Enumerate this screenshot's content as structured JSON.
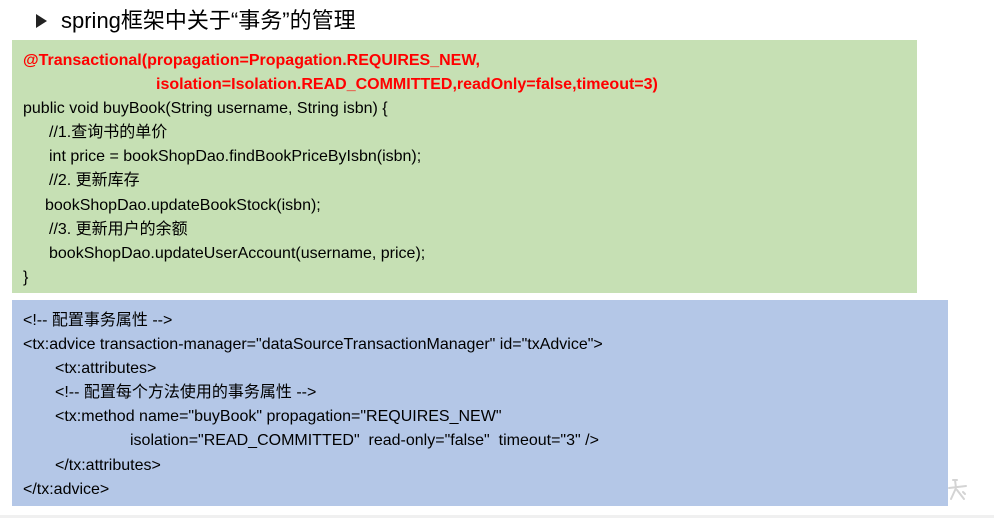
{
  "heading": {
    "text": "spring框架中关于“事务”的管理"
  },
  "java_code": {
    "annotation_line1": "@Transactional(propagation=Propagation.REQUIRES_NEW,",
    "annotation_line2": "isolation=Isolation.READ_COMMITTED,readOnly=false,timeout=3)",
    "method_signature": "public void buyBook(String username, String isbn) {",
    "comment1": "//1.查询书的单价",
    "line_price": "int price = bookShopDao.findBookPriceByIsbn(isbn);",
    "comment2": "//2. 更新库存",
    "line_stock": "bookShopDao.updateBookStock(isbn);",
    "comment3": "//3. 更新用户的余额",
    "line_account": "bookShopDao.updateUserAccount(username, price);",
    "closing_brace": "}"
  },
  "xml_config": {
    "comment1": "<!-- 配置事务属性 -->",
    "advice_open": "<tx:advice transaction-manager=\"dataSourceTransactionManager\" id=\"txAdvice\">",
    "attributes_open": "<tx:attributes>",
    "comment2": "<!-- 配置每个方法使用的事务属性 -->",
    "method_line1": "<tx:method name=\"buyBook\" propagation=\"REQUIRES_NEW\"",
    "method_line2": "isolation=\"READ_COMMITTED\"  read-only=\"false\"  timeout=\"3\" />",
    "attributes_close": "</tx:attributes>",
    "advice_close": "</tx:advice>"
  },
  "colors": {
    "green_box": "#c6e0b4",
    "blue_box": "#b4c7e7",
    "annotation_red": "#ff0000"
  },
  "icons": {
    "bullet": "arrow-bullet-icon",
    "watermark": "watermark-logo-icon"
  }
}
